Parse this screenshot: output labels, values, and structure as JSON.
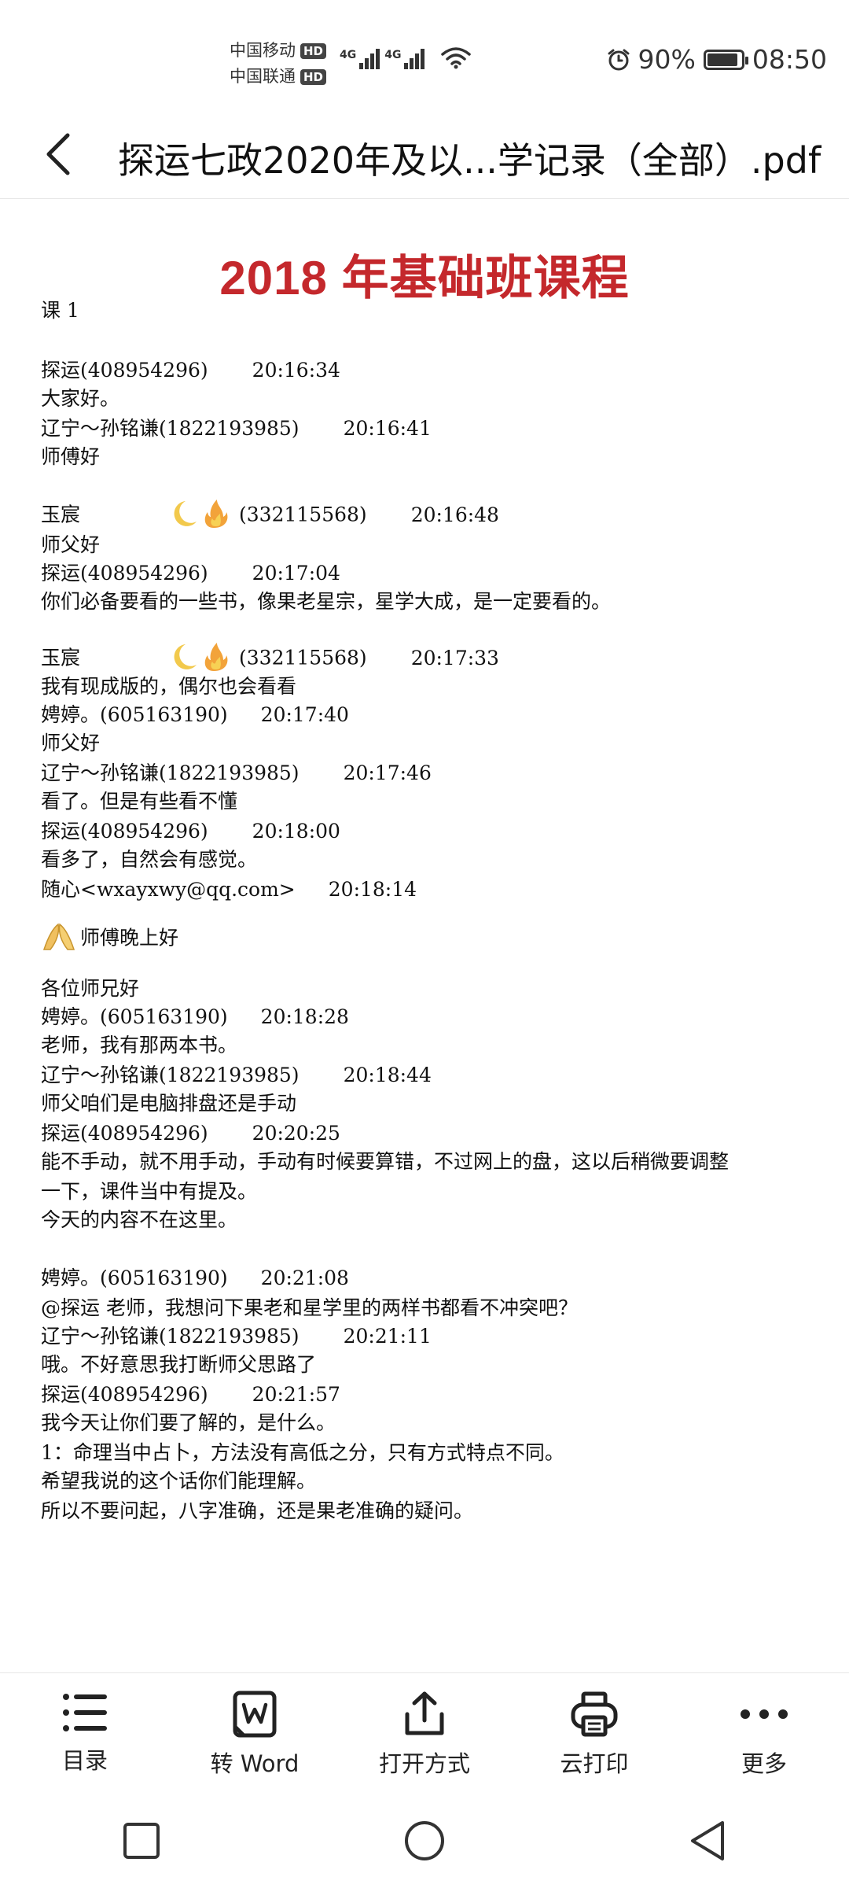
{
  "status_bar": {
    "carrier_1": "中国移动",
    "carrier_2": "中国联通",
    "hd_badge": "HD",
    "network_1": "4G",
    "network_2": "4G",
    "battery_percent": "90%",
    "battery_level": 0.9,
    "time": "08:50"
  },
  "header": {
    "title": "探运七政2020年及以...学记录（全部）.pdf"
  },
  "document": {
    "heading": "2018 年基础班课程",
    "lesson": "课 1",
    "lines": [
      {
        "name": "探运(408954296)",
        "time": "20:16:34"
      },
      {
        "text": "大家好。"
      },
      {
        "name": "辽宁～孙铭谦(1822193985)",
        "time": "20:16:41"
      },
      {
        "text": "师傅好"
      },
      {
        "name": "玉宸",
        "id": "(332115568)",
        "time": "20:16:48"
      },
      {
        "text": "师父好"
      },
      {
        "name": "探运(408954296)",
        "time": "20:17:04"
      },
      {
        "text": "你们必备要看的一些书，像果老星宗，星学大成，是一定要看的。"
      },
      {
        "name": "玉宸",
        "id": "(332115568)",
        "time": "20:17:33"
      },
      {
        "text": "我有现成版的，偶尔也会看看"
      },
      {
        "name": "娉婷。(605163190)",
        "time": "20:17:40"
      },
      {
        "text": "师父好"
      },
      {
        "name": "辽宁～孙铭谦(1822193985)",
        "time": "20:17:46"
      },
      {
        "text": "看了。但是有些看不懂"
      },
      {
        "name": "探运(408954296)",
        "time": "20:18:00"
      },
      {
        "text": "看多了，自然会有感觉。"
      },
      {
        "name": "随心<wxayxwy@qq.com>",
        "time": "20:18:14"
      },
      {
        "text": "师傅晚上好"
      },
      {
        "text": "各位师兄好"
      },
      {
        "name": "娉婷。(605163190)",
        "time": "20:18:28"
      },
      {
        "text": "老师，我有那两本书。"
      },
      {
        "name": "辽宁～孙铭谦(1822193985)",
        "time": "20:18:44"
      },
      {
        "text": "师父咱们是电脑排盘还是手动"
      },
      {
        "name": "探运(408954296)",
        "time": "20:20:25"
      },
      {
        "text": "能不手动，就不用手动，手动有时候要算错，不过网上的盘，这以后稍微要调整"
      },
      {
        "text": "一下，课件当中有提及。"
      },
      {
        "text": "今天的内容不在这里。"
      },
      {
        "name": "娉婷。(605163190)",
        "time": "20:21:08"
      },
      {
        "text": "@探运  老师，我想问下果老和星学里的两样书都看不冲突吧？"
      },
      {
        "name": "辽宁～孙铭谦(1822193985)",
        "time": "20:21:11"
      },
      {
        "text": "哦。不好意思我打断师父思路了"
      },
      {
        "name": "探运(408954296)",
        "time": "20:21:57"
      },
      {
        "text": "我今天让你们要了解的，是什么。"
      },
      {
        "text": "1：命理当中占卜，方法没有高低之分，只有方式特点不同。"
      },
      {
        "text": "希望我说的这个话你们能理解。"
      },
      {
        "text": "所以不要问起，八字准确，还是果老准确的疑问。"
      }
    ]
  },
  "toolbar": {
    "items": [
      {
        "label": "目录",
        "icon": "list-icon"
      },
      {
        "label": "转 Word",
        "icon": "word-convert-icon"
      },
      {
        "label": "打开方式",
        "icon": "share-icon"
      },
      {
        "label": "云打印",
        "icon": "print-icon"
      },
      {
        "label": "更多",
        "icon": "more-icon"
      }
    ]
  },
  "navbar": {
    "items": [
      {
        "icon": "recents-square-icon"
      },
      {
        "icon": "home-circle-icon"
      },
      {
        "icon": "back-triangle-icon"
      }
    ]
  }
}
